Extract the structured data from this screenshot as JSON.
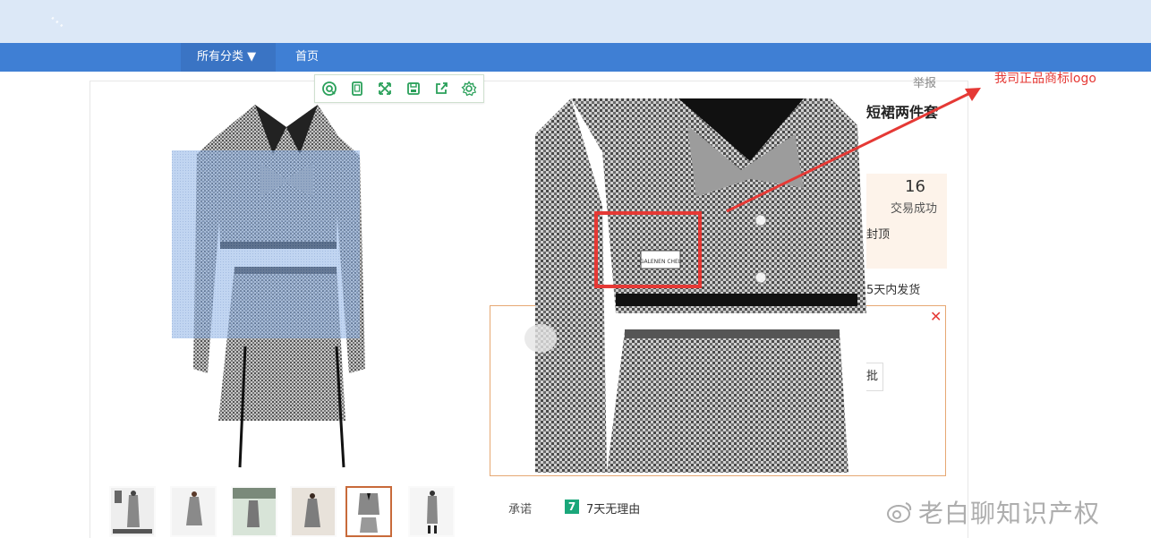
{
  "watermark_top_left": "...",
  "nav": {
    "category_label": "所有分类 ▼",
    "home_label": "首页"
  },
  "toolbar": {
    "icons": [
      "search-icon",
      "copy-icon",
      "expand-icon",
      "save-icon",
      "share-icon",
      "settings-icon"
    ]
  },
  "report_label": "举报",
  "annotation_text": "我司正品商标logo",
  "label_tag": "GALENEN CHEL",
  "title_fragment": "短裙两件套",
  "stats": {
    "count": "16",
    "count_label": "交易成功",
    "fragment": "封顶"
  },
  "shipping": "5天内发货",
  "popup": {
    "close_icon": "✕",
    "button_fragment": "批"
  },
  "promise": {
    "label": "承诺",
    "badge": "7",
    "text": "7天无理由"
  },
  "watermark_bottom_right": "老白聊知识产权",
  "colors": {
    "nav": "#3f7fd4",
    "top_band": "#dce8f7",
    "accent_red": "#e53935",
    "popup_border": "#e6a873",
    "badge_green": "#1aa77a"
  }
}
